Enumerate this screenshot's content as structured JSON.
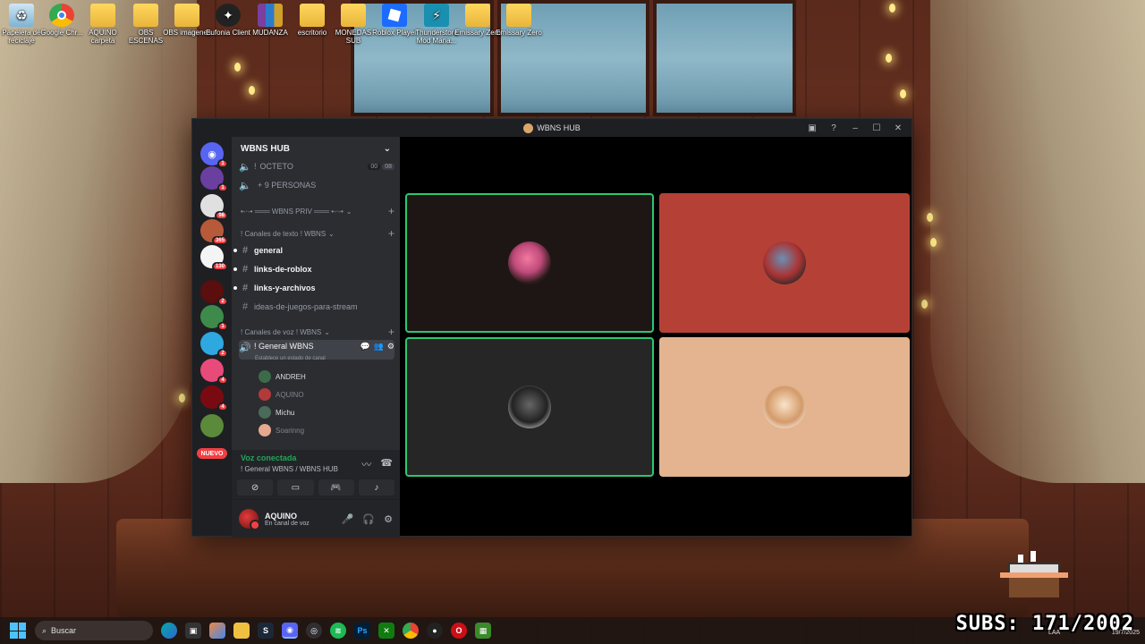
{
  "desktop": {
    "icons": [
      {
        "label": "Papelera de reciclaje",
        "icon": "recycle-bin-icon"
      },
      {
        "label": "Google Chr...",
        "icon": "chrome-icon"
      },
      {
        "label": "AQUINO carpeta",
        "icon": "folder-icon"
      },
      {
        "label": "OBS ESCENAS",
        "icon": "folder-icon"
      },
      {
        "label": "OBS imagenes",
        "icon": "folder-icon"
      },
      {
        "label": "Eufonia Client",
        "icon": "eufonia-icon"
      },
      {
        "label": "MUDANZA",
        "icon": "archive-icon"
      },
      {
        "label": "escritorio",
        "icon": "folder-icon"
      },
      {
        "label": "MONEDAS SUB",
        "icon": "folder-icon"
      },
      {
        "label": "Roblox Player",
        "icon": "roblox-icon"
      },
      {
        "label": "Thunderstore Mod Mana...",
        "icon": "thunderstore-icon"
      },
      {
        "label": "Emissary Zero",
        "icon": "folder-icon"
      },
      {
        "label": "Emissary Zero",
        "icon": "folder-icon"
      }
    ]
  },
  "discord": {
    "window_title": "WBNS HUB",
    "server_name": "WBNS HUB",
    "guild_badges": [
      "1",
      "1",
      "98",
      "365",
      "130",
      "2",
      "1",
      "2",
      "4",
      "4"
    ],
    "nuevo_label": "NUEVO",
    "channels_top": [
      {
        "name": "OCTETO",
        "prefix": "!",
        "extra_left": "00",
        "extra_right": "08"
      },
      {
        "name": "+ 9 PERSONAS",
        "prefix": ""
      }
    ],
    "category_priv": "•-‧-• ═══ WBNS PRIV ═══ •-‧-•",
    "category_text": "! Canales de texto ! WBNS",
    "text_channels": [
      {
        "name": "general",
        "unread": true
      },
      {
        "name": "links-de-roblox",
        "unread": true
      },
      {
        "name": "links-y-archivos",
        "unread": true
      },
      {
        "name": "ideas-de-juegos-para-stream",
        "unread": false
      }
    ],
    "category_voice": "! Canales de voz ! WBNS",
    "voice_channel": {
      "name": "! General WBNS",
      "status": "Establece un estado de canal"
    },
    "voice_users": [
      {
        "name": "ANDREH",
        "muted": false,
        "color": "#3c6b4a"
      },
      {
        "name": "AQUINO",
        "muted": true,
        "color": "#b23a3a"
      },
      {
        "name": "Michu",
        "muted": false,
        "color": "#4a6a5a"
      },
      {
        "name": "Soarinng",
        "muted": true,
        "color": "#e6a890"
      }
    ],
    "voice_panel": {
      "status": "Voz conectada",
      "channel": "! General WBNS / WBNS HUB"
    },
    "user_panel": {
      "name": "AQUINO",
      "status": "En canal de voz"
    },
    "tiles": [
      {
        "bg": "#1e1614",
        "speaking": true,
        "avatar": "#c04a7a"
      },
      {
        "bg": "#b54136",
        "speaking": false,
        "avatar": "#6a8fb4"
      },
      {
        "bg": "#262626",
        "speaking": true,
        "avatar": "#3a3a3a"
      },
      {
        "bg": "#e3b48f",
        "speaking": false,
        "avatar": "#f1d7b5"
      }
    ]
  },
  "taskbar": {
    "search_placeholder": "Buscar",
    "subs_text": "SUBS: 171/2002",
    "tray_lang": "LAA",
    "date": "19/7/2025"
  },
  "colors": {
    "discord_green": "#23a55a",
    "discord_red": "#f23f43",
    "speaking_border": "#2dc770"
  }
}
